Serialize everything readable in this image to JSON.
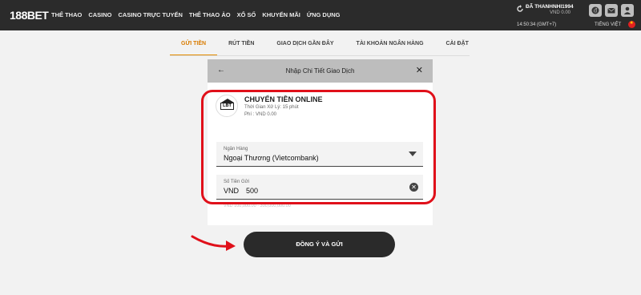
{
  "brand": {
    "logo_text": "188BET"
  },
  "nav": [
    "THỂ THAO",
    "CASINO",
    "CASINO TRỰC TUYẾN",
    "THỂ THAO ẢO",
    "XỔ SỐ",
    "KHUYẾN MÃI",
    "ỨNG DỤNG"
  ],
  "user": {
    "name": "ĐÃ THANHNHI1994",
    "balance": "VND 0.00",
    "time": "14:50:34 (GMT+7)",
    "language": "TIẾNG VIỆT"
  },
  "tabs": [
    {
      "label": "GỬI TIỀN",
      "active": true
    },
    {
      "label": "RÚT TIỀN",
      "active": false
    },
    {
      "label": "GIAO DỊCH GẦN ĐÂY",
      "active": false
    },
    {
      "label": "TÀI KHOẢN NGÂN HÀNG",
      "active": false
    },
    {
      "label": "CÀI ĐẶT",
      "active": false
    }
  ],
  "modal": {
    "title": "Nhập Chi Tiết Giao Dịch",
    "method": {
      "logo_text": "LBT",
      "name": "CHUYỂN TIỀN ONLINE",
      "time": "Thời Gian Xử Lý: 15 phút",
      "fee": "Phí : VND 0.00"
    },
    "bank_field": {
      "label": "Ngân Hàng",
      "value": "Ngoại Thương (Vietcombank)"
    },
    "amount_field": {
      "label": "Số Tiền Gửi",
      "currency": "VND",
      "value": "500"
    },
    "limit_text": "VND 100,000.00 - 300,000,000.00",
    "submit_label": "ĐỒNG Ý VÀ GỬI"
  },
  "colors": {
    "accent": "#e38b00",
    "highlight": "#e0101a",
    "header_bg": "#2b2b2b"
  }
}
